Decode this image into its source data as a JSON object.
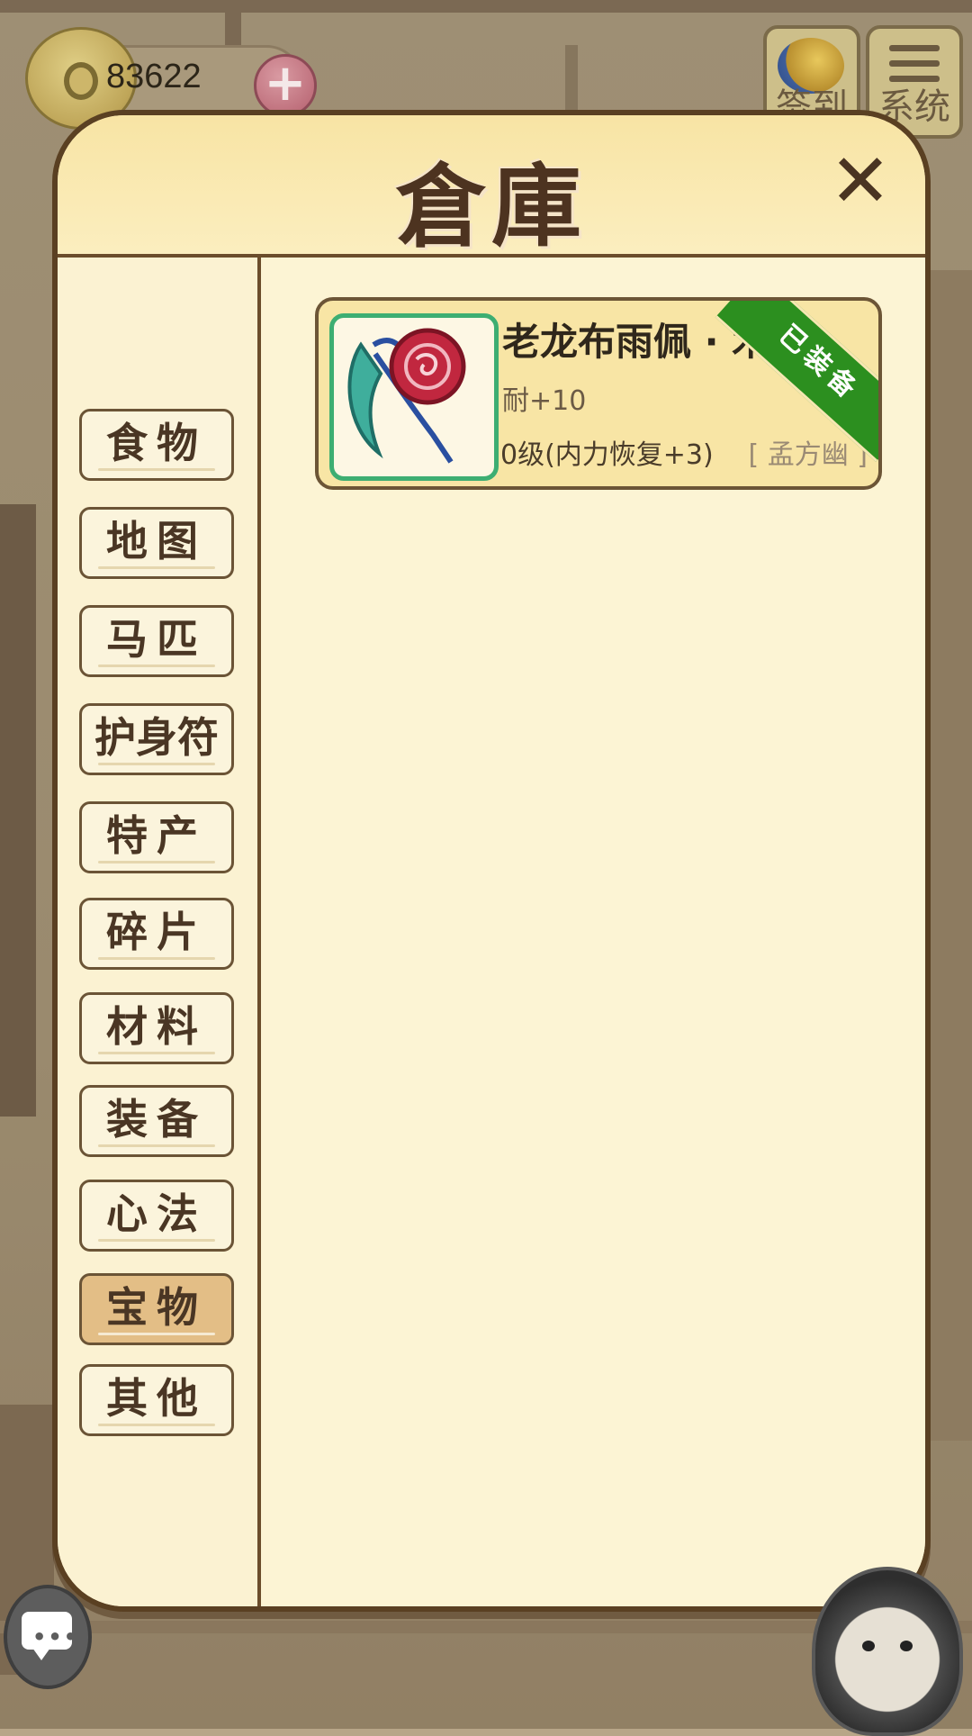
{
  "hud": {
    "coins": "83622",
    "plus_label": "+",
    "checkin_label": "签到",
    "system_label": "系统"
  },
  "panel": {
    "title": "倉庫",
    "close_label": "✕"
  },
  "categories": [
    {
      "label": "食物",
      "active": false
    },
    {
      "label": "地图",
      "active": false
    },
    {
      "label": "马匹",
      "active": false
    },
    {
      "label": "护身符",
      "active": false
    },
    {
      "label": "特产",
      "active": false
    },
    {
      "label": "碎片",
      "active": false
    },
    {
      "label": "材料",
      "active": false
    },
    {
      "label": "装备",
      "active": false
    },
    {
      "label": "心法",
      "active": false
    },
    {
      "label": "宝物",
      "active": true
    },
    {
      "label": "其他",
      "active": false
    }
  ],
  "items": [
    {
      "name": "老龙布雨佩 · 木",
      "stat": "耐+10",
      "effect": "0级(内力恢复+3)",
      "owner": "[ 孟方幽 ]",
      "badge": "已装备",
      "icon": "jade-pendant-icon"
    }
  ],
  "colors": {
    "panel_bg": "#fbf3d2",
    "header_bg": "#f8e4a4",
    "active_tab": "#e3be86",
    "badge": "#2c8f1f",
    "thumb_border": "#3dae72"
  }
}
